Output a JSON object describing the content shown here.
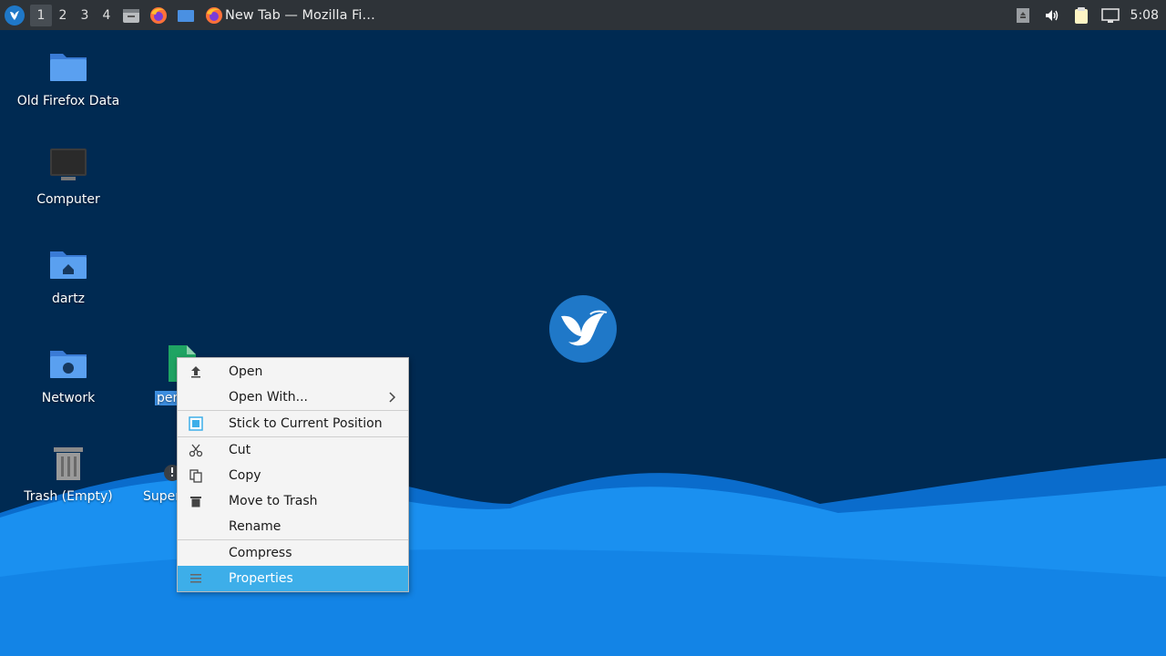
{
  "taskbar": {
    "workspaces": [
      "1",
      "2",
      "3",
      "4"
    ],
    "active_workspace": "1",
    "task_title": "New Tab — Mozilla Fi…",
    "clock": "5:08",
    "launchers": [
      "file-manager-icon",
      "firefox-icon",
      "desktop-icon"
    ],
    "tray": [
      "removable-drive-icon",
      "volume-icon",
      "clipboard-icon",
      "network-icon"
    ]
  },
  "desktop": {
    "icons": [
      {
        "label": "Old Firefox Data",
        "icon": "folder-icon"
      },
      {
        "label": "Computer",
        "icon": "computer-icon"
      },
      {
        "label": "dartz",
        "icon": "home-folder-icon"
      },
      {
        "label": "Network",
        "icon": "network-folder-icon"
      },
      {
        "label": "Trash (Empty)",
        "icon": "trash-icon"
      },
      {
        "label": "per",
        "icon": "spreadsheet-file-icon"
      },
      {
        "label": "Super",
        "icon": "script-file-icon"
      }
    ]
  },
  "context_menu": {
    "items": [
      {
        "label": "Open",
        "icon": "open-icon"
      },
      {
        "label": "Open With...",
        "icon": "",
        "submenu": true
      },
      {
        "label": "Stick to Current Position",
        "icon": "checkbox-icon",
        "checked": true
      },
      {
        "label": "Cut",
        "icon": "scissors-icon"
      },
      {
        "label": "Copy",
        "icon": "copy-icon"
      },
      {
        "label": "Move to Trash",
        "icon": "trash-can-icon"
      },
      {
        "label": "Rename",
        "icon": ""
      },
      {
        "label": "Compress",
        "icon": ""
      },
      {
        "label": "Properties",
        "icon": "properties-icon",
        "highlighted": true
      }
    ]
  },
  "colors": {
    "taskbar_bg": "#2e3338",
    "desktop_bg": "#002a52",
    "wave_light": "#1a90f0",
    "highlight": "#3daee9",
    "selection": "#3d8ee0"
  }
}
